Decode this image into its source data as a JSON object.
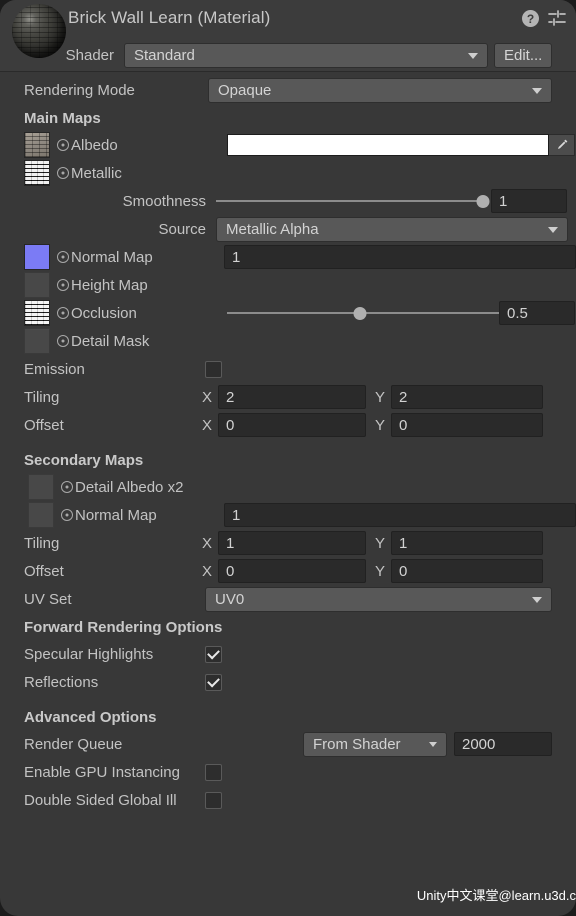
{
  "header": {
    "material_title": "Brick Wall Learn (Material)",
    "help_icon": "help-icon",
    "settings_icon": "settings-sliders-icon",
    "shader_label": "Shader",
    "shader_value": "Standard",
    "edit_label": "Edit..."
  },
  "rendering_mode": {
    "label": "Rendering Mode",
    "value": "Opaque"
  },
  "main_maps": {
    "heading": "Main Maps",
    "albedo": {
      "label": "Albedo",
      "color": "#ffffff",
      "has_texture": true
    },
    "metallic": {
      "label": "Metallic",
      "has_texture": true
    },
    "smoothness": {
      "label": "Smoothness",
      "value": "1",
      "percent": 100
    },
    "source": {
      "label": "Source",
      "value": "Metallic Alpha"
    },
    "normal_map": {
      "label": "Normal Map",
      "value": "1",
      "has_texture": true
    },
    "height_map": {
      "label": "Height Map",
      "has_texture": false
    },
    "occlusion": {
      "label": "Occlusion",
      "value": "0.5",
      "percent": 48,
      "has_texture": true
    },
    "detail_mask": {
      "label": "Detail Mask",
      "has_texture": false
    },
    "emission": {
      "label": "Emission",
      "checked": false
    },
    "tiling": {
      "label": "Tiling",
      "x_label": "X",
      "x": "2",
      "y_label": "Y",
      "y": "2"
    },
    "offset": {
      "label": "Offset",
      "x_label": "X",
      "x": "0",
      "y_label": "Y",
      "y": "0"
    }
  },
  "secondary_maps": {
    "heading": "Secondary Maps",
    "detail_albedo": {
      "label": "Detail Albedo x2",
      "has_texture": false
    },
    "normal_map": {
      "label": "Normal Map",
      "value": "1",
      "has_texture": false
    },
    "tiling": {
      "label": "Tiling",
      "x_label": "X",
      "x": "1",
      "y_label": "Y",
      "y": "1"
    },
    "offset": {
      "label": "Offset",
      "x_label": "X",
      "x": "0",
      "y_label": "Y",
      "y": "0"
    },
    "uv_set": {
      "label": "UV Set",
      "value": "UV0"
    }
  },
  "forward_rendering": {
    "heading": "Forward Rendering Options",
    "specular_highlights": {
      "label": "Specular Highlights",
      "checked": true
    },
    "reflections": {
      "label": "Reflections",
      "checked": true
    }
  },
  "advanced": {
    "heading": "Advanced Options",
    "render_queue": {
      "label": "Render Queue",
      "mode": "From Shader",
      "value": "2000"
    },
    "gpu_instancing": {
      "label": "Enable GPU Instancing",
      "checked": false
    },
    "double_sided_gi": {
      "label": "Double Sided Global Ill",
      "checked": false
    }
  },
  "watermark": "Unity中文课堂@learn.u3d.c"
}
